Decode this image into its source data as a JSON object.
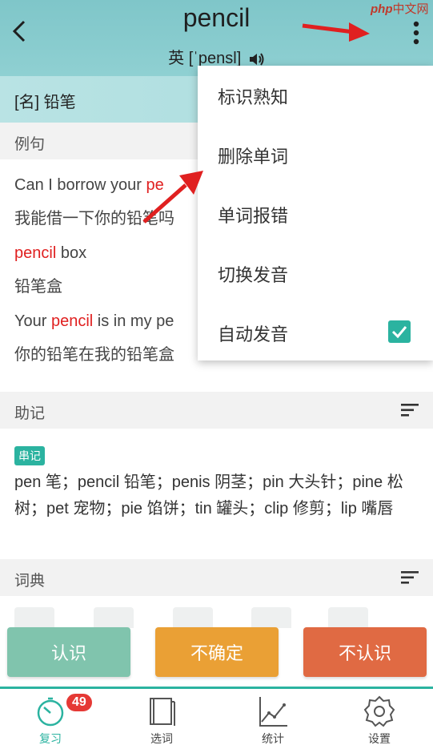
{
  "watermark": {
    "php": "php",
    "site": "中文网"
  },
  "header": {
    "word": "pencil",
    "phonetic_label": "英",
    "phonetic": "[ˈpensl]"
  },
  "definition": "[名] 铅笔",
  "examples": {
    "section_label": "例句",
    "items": [
      {
        "en_pre": "Can I borrow your ",
        "en_hl": "pe",
        "en_post": "",
        "zh": "我能借一下你的铅笔吗"
      },
      {
        "en_pre": "",
        "en_hl": "pencil",
        "en_post": " box",
        "zh": "铅笔盒"
      },
      {
        "en_pre": "Your ",
        "en_hl": "pencil",
        "en_post": " is in my pe",
        "zh": "你的铅笔在我的铅笔盒"
      }
    ]
  },
  "mnemonic": {
    "section_label": "助记",
    "tag": "串记",
    "text": "pen 笔；pencil 铅笔；penis 阴茎；pin 大头针；pine 松树；pet 宠物；pie 馅饼；tin 罐头；clip 修剪；lip 嘴唇"
  },
  "dictionary": {
    "section_label": "词典"
  },
  "buttons": {
    "know": "认识",
    "unsure": "不确定",
    "unknown": "不认识"
  },
  "tabs": [
    {
      "label": "复习",
      "badge": "49",
      "active": true
    },
    {
      "label": "选词"
    },
    {
      "label": "统计"
    },
    {
      "label": "设置"
    }
  ],
  "menu": {
    "items": [
      "标识熟知",
      "删除单词",
      "单词报错",
      "切换发音",
      "自动发音"
    ],
    "auto_pronounce_checked": true
  },
  "colors": {
    "accent": "#2bb3a0",
    "highlight": "#e02020",
    "header": "#8fd0d2"
  }
}
